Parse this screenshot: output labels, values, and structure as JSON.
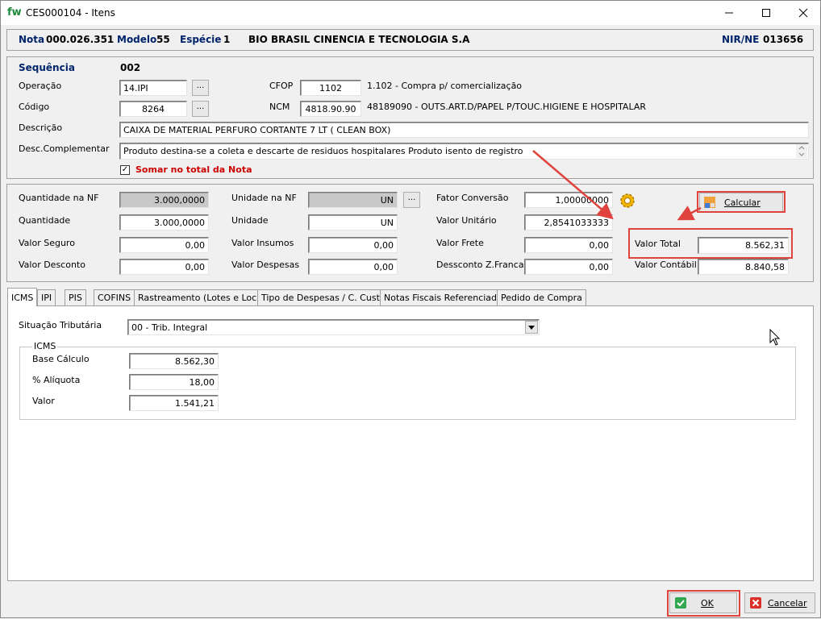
{
  "window": {
    "app_logo": "fw",
    "title": "CES000104 -  Itens"
  },
  "header": {
    "nota_label": "Nota",
    "nota_value": "000.026.351",
    "modelo_label": "Modelo",
    "modelo_value": "55",
    "especie_label": "Espécie",
    "especie_value": "1",
    "empresa": "BIO BRASIL CINENCIA E TECNOLOGIA S.A",
    "nir_label": "NIR/NE",
    "nir_value": "013656"
  },
  "item": {
    "sequencia_label": "Sequência",
    "sequencia_value": "002",
    "operacao_label": "Operação",
    "operacao_value": "14.IPI",
    "codigo_label": "Código",
    "codigo_value": "8264",
    "cfop_label": "CFOP",
    "cfop_value": "1102",
    "cfop_desc": "1.102 - Compra p/ comercialização",
    "ncm_label": "NCM",
    "ncm_value": "4818.90.90",
    "ncm_desc": "48189090 - OUTS.ART.D/PAPEL P/TOUC.HIGIENE E HOSPITALAR",
    "descricao_label": "Descrição",
    "descricao_value": "CAIXA DE MATERIAL PERFURO CORTANTE 7 LT ( CLEAN BOX)",
    "desc_comp_label": "Desc.Complementar",
    "desc_comp_value": "Produto destina-se a coleta e descarte de residuos hospitalares Produto isento de registro",
    "somar_label": "Somar no total da Nota",
    "somar_checked": "✓",
    "dots": "..."
  },
  "valores": {
    "qtd_nf_label": "Quantidade na NF",
    "qtd_nf_value": "3.000,0000",
    "quantidade_label": "Quantidade",
    "quantidade_value": "3.000,0000",
    "valor_seguro_label": "Valor Seguro",
    "valor_seguro_value": "0,00",
    "valor_desconto_label": "Valor Desconto",
    "valor_desconto_value": "0,00",
    "unidade_nf_label": "Unidade na NF",
    "unidade_nf_value": "UN",
    "unidade_label": "Unidade",
    "unidade_value": "UN",
    "valor_insumos_label": "Valor Insumos",
    "valor_insumos_value": "0,00",
    "valor_despesas_label": "Valor Despesas",
    "valor_despesas_value": "0,00",
    "fator_label": "Fator Conversão",
    "fator_value": "1,00000000",
    "valor_unitario_label": "Valor Unitário",
    "valor_unitario_value": "2,8541033333",
    "valor_frete_label": "Valor Frete",
    "valor_frete_value": "0,00",
    "desconto_zf_label": "Dessconto Z.Franca",
    "desconto_zf_value": "0,00",
    "valor_total_label": "Valor Total",
    "valor_total_value": "8.562,31",
    "valor_contabil_label": "Valor Contábil",
    "valor_contabil_value": "8.840,58",
    "calcular_label": "Calcular"
  },
  "tabs": [
    {
      "label": "ICMS"
    },
    {
      "label": "IPI"
    },
    {
      "label": "PIS"
    },
    {
      "label": "COFINS"
    },
    {
      "label": "Rastreamento (Lotes e Locais)"
    },
    {
      "label": "Tipo de Despesas / C. Custos"
    },
    {
      "label": "Notas Fiscais Referenciadas"
    },
    {
      "label": "Pedido de Compra"
    }
  ],
  "icms": {
    "situacao_label": "Situação Tributária",
    "situacao_value": "00  - Trib. Integral",
    "group_label": "ICMS",
    "base_label": "Base Cálculo",
    "base_value": "8.562,30",
    "aliquota_label": "% Alíquota",
    "aliquota_value": "18,00",
    "valor_label": "Valor",
    "valor_value": "1.541,21"
  },
  "footer": {
    "ok_label": "OK",
    "cancelar_label": "Cancelar"
  },
  "colors": {
    "highlight": "#e0433d",
    "header_blue": "#00246b",
    "warning_red": "#cc0000"
  }
}
